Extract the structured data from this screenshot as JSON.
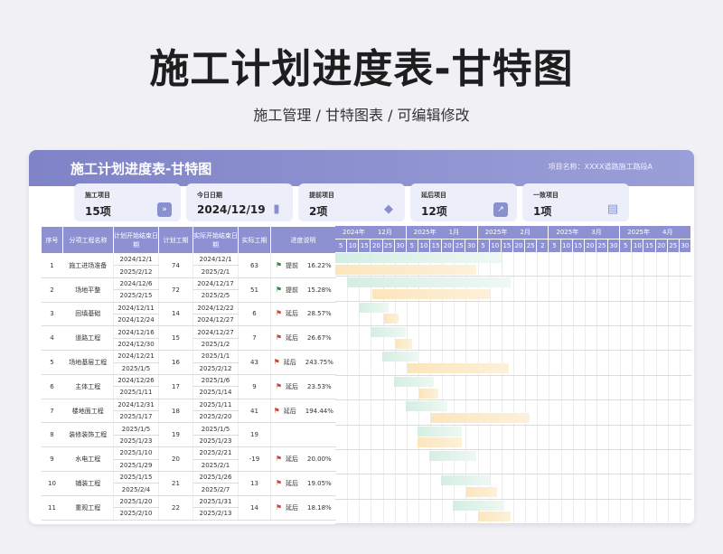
{
  "page": {
    "title": "施工计划进度表-甘特图",
    "subtitle": "施工管理 / 甘特图表 / 可编辑修改"
  },
  "sheet": {
    "title": "施工计划进度表-甘特图",
    "project_label": "项目名称：XXXX道路施工路段A"
  },
  "stats": [
    {
      "label": "施工项目",
      "value": "15项",
      "icon": "double-arrow-icon"
    },
    {
      "label": "今日日期",
      "value": "2024/12/19",
      "icon": "bar-chart-icon"
    },
    {
      "label": "提前项目",
      "value": "2项",
      "icon": "tag-icon"
    },
    {
      "label": "延后项目",
      "value": "12项",
      "icon": "trend-icon"
    },
    {
      "label": "一致项目",
      "value": "1项",
      "icon": "document-icon"
    }
  ],
  "columns": [
    "序号",
    "分项工程名称",
    "计划开始结束日期",
    "计划工期",
    "实际开始结束日期",
    "实际工期",
    "进度说明"
  ],
  "gantt_months": [
    {
      "label": "2024年",
      "month": "12月"
    },
    {
      "label": "2025年",
      "month": "1月"
    },
    {
      "label": "2025年",
      "month": "2月"
    },
    {
      "label": "2025年",
      "month": "3月"
    },
    {
      "label": "2025年",
      "month": "4月"
    }
  ],
  "gantt_days": [
    "5",
    "10",
    "15",
    "20",
    "25",
    "30",
    "5",
    "10",
    "15",
    "20",
    "25",
    "30",
    "5",
    "10",
    "15",
    "20",
    "25",
    "2",
    "5",
    "10",
    "15",
    "20",
    "25",
    "30",
    "5",
    "10",
    "15",
    "20",
    "25",
    "30"
  ],
  "rows": [
    {
      "no": "1",
      "name": "施工进场准备",
      "plan_start": "2024/12/1",
      "plan_end": "2025/2/12",
      "plan_days": "74",
      "real_start": "2024/12/1",
      "real_end": "2025/2/1",
      "real_days": "63",
      "status": "提前",
      "pct": "16.22%",
      "flag": "early",
      "plan_bar": [
        0,
        0.466
      ],
      "real_bar": [
        0,
        0.395
      ]
    },
    {
      "no": "2",
      "name": "场地平整",
      "plan_start": "2024/12/6",
      "plan_end": "2025/2/15",
      "plan_days": "72",
      "real_start": "2024/12/17",
      "real_end": "2025/2/5",
      "real_days": "51",
      "status": "提前",
      "pct": "15.28%",
      "flag": "early",
      "plan_bar": [
        0.033,
        0.493
      ],
      "real_bar": [
        0.105,
        0.434
      ]
    },
    {
      "no": "3",
      "name": "回填基础",
      "plan_start": "2024/12/11",
      "plan_end": "2024/12/24",
      "plan_days": "14",
      "real_start": "2024/12/22",
      "real_end": "2024/12/27",
      "real_days": "6",
      "status": "延后",
      "pct": "28.57%",
      "flag": "late",
      "plan_bar": [
        0.066,
        0.151
      ],
      "real_bar": [
        0.138,
        0.178
      ]
    },
    {
      "no": "4",
      "name": "道路工程",
      "plan_start": "2024/12/16",
      "plan_end": "2024/12/30",
      "plan_days": "15",
      "real_start": "2024/12/27",
      "real_end": "2025/1/2",
      "real_days": "7",
      "status": "延后",
      "pct": "26.67%",
      "flag": "late",
      "plan_bar": [
        0.099,
        0.197
      ],
      "real_bar": [
        0.171,
        0.217
      ]
    },
    {
      "no": "5",
      "name": "场地基层工程",
      "plan_start": "2024/12/21",
      "plan_end": "2025/1/5",
      "plan_days": "16",
      "real_start": "2025/1/1",
      "real_end": "2025/2/12",
      "real_days": "43",
      "status": "延后",
      "pct": "243.75%",
      "flag": "late",
      "plan_bar": [
        0.132,
        0.237
      ],
      "real_bar": [
        0.204,
        0.487
      ]
    },
    {
      "no": "6",
      "name": "主体工程",
      "plan_start": "2024/12/26",
      "plan_end": "2025/1/11",
      "plan_days": "17",
      "real_start": "2025/1/6",
      "real_end": "2025/1/14",
      "real_days": "9",
      "status": "延后",
      "pct": "23.53%",
      "flag": "late",
      "plan_bar": [
        0.164,
        0.276
      ],
      "real_bar": [
        0.237,
        0.289
      ]
    },
    {
      "no": "7",
      "name": "楼地面工程",
      "plan_start": "2024/12/31",
      "plan_end": "2025/1/17",
      "plan_days": "18",
      "real_start": "2025/1/11",
      "real_end": "2025/2/20",
      "real_days": "41",
      "status": "延后",
      "pct": "194.44%",
      "flag": "late",
      "plan_bar": [
        0.197,
        0.316
      ],
      "real_bar": [
        0.27,
        0.546
      ]
    },
    {
      "no": "8",
      "name": "装修装饰工程",
      "plan_start": "2025/1/5",
      "plan_end": "2025/1/23",
      "plan_days": "19",
      "real_start": "2025/1/5",
      "real_end": "2025/1/23",
      "real_days": "19",
      "status": "",
      "pct": "",
      "flag": "none",
      "plan_bar": [
        0.23,
        0.355
      ],
      "real_bar": [
        0.23,
        0.355
      ]
    },
    {
      "no": "9",
      "name": "水电工程",
      "plan_start": "2025/1/10",
      "plan_end": "2025/1/29",
      "plan_days": "20",
      "real_start": "2025/2/21",
      "real_end": "2025/2/1",
      "real_days": "-19",
      "status": "延后",
      "pct": "20.00%",
      "flag": "late",
      "plan_bar": [
        0.263,
        0.395
      ],
      "real_bar": null
    },
    {
      "no": "10",
      "name": "铺装工程",
      "plan_start": "2025/1/15",
      "plan_end": "2025/2/4",
      "plan_days": "21",
      "real_start": "2025/1/26",
      "real_end": "2025/2/7",
      "real_days": "13",
      "status": "延后",
      "pct": "19.05%",
      "flag": "late",
      "plan_bar": [
        0.296,
        0.434
      ],
      "real_bar": [
        0.368,
        0.454
      ]
    },
    {
      "no": "11",
      "name": "重观工程",
      "plan_start": "2025/1/20",
      "plan_end": "2025/2/10",
      "plan_days": "22",
      "real_start": "2025/1/31",
      "real_end": "2025/2/13",
      "real_days": "14",
      "status": "延后",
      "pct": "18.18%",
      "flag": "late",
      "plan_bar": [
        0.329,
        0.474
      ],
      "real_bar": [
        0.401,
        0.493
      ]
    }
  ]
}
